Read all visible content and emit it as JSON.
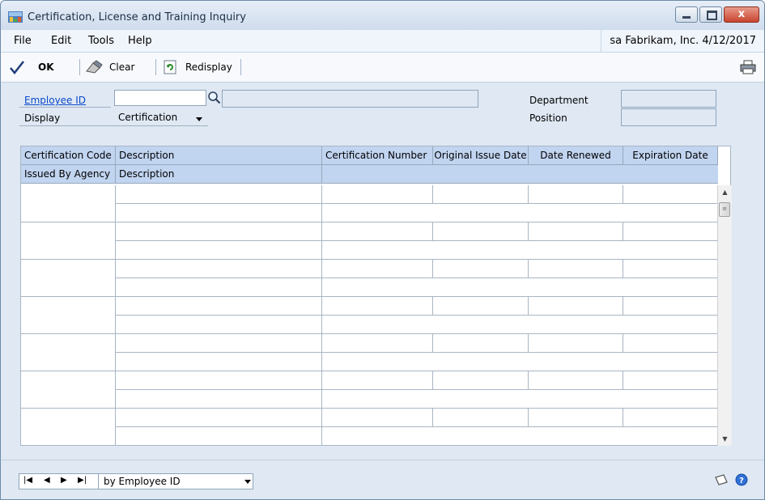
{
  "window": {
    "title": "Certification, License and Training Inquiry",
    "close_label": "x"
  },
  "menu": {
    "items": [
      "File",
      "Edit",
      "Tools",
      "Help"
    ],
    "user_info": "sa  Fabrikam, Inc.  4/12/2017"
  },
  "toolbar": {
    "ok_label": "OK",
    "clear_label": "Clear",
    "redisplay_label": "Redisplay"
  },
  "form": {
    "employee_id_label": "Employee ID",
    "employee_id_value": "",
    "employee_name_value": "",
    "display_label": "Display",
    "display_value": "Certification",
    "department_label": "Department",
    "department_value": "",
    "position_label": "Position",
    "position_value": ""
  },
  "grid": {
    "header_row1": [
      "Certification Code",
      "Description",
      "Certification Number",
      "Original Issue Date",
      "Date Renewed",
      "Expiration Date"
    ],
    "header_row2": [
      "Issued By Agency",
      "Description"
    ],
    "rows": []
  },
  "statusbar": {
    "sort_value": "by Employee ID"
  },
  "colors": {
    "header_bg": "#c1d4f0",
    "window_bg": "#dfe8f3",
    "link": "#0b49c8"
  },
  "icons": [
    "app-icon",
    "checkmark-icon",
    "eraser-icon",
    "redisplay-icon",
    "print-icon",
    "lookup-icon",
    "first-record-icon",
    "previous-record-icon",
    "next-record-icon",
    "last-record-icon",
    "note-icon",
    "help-icon"
  ]
}
